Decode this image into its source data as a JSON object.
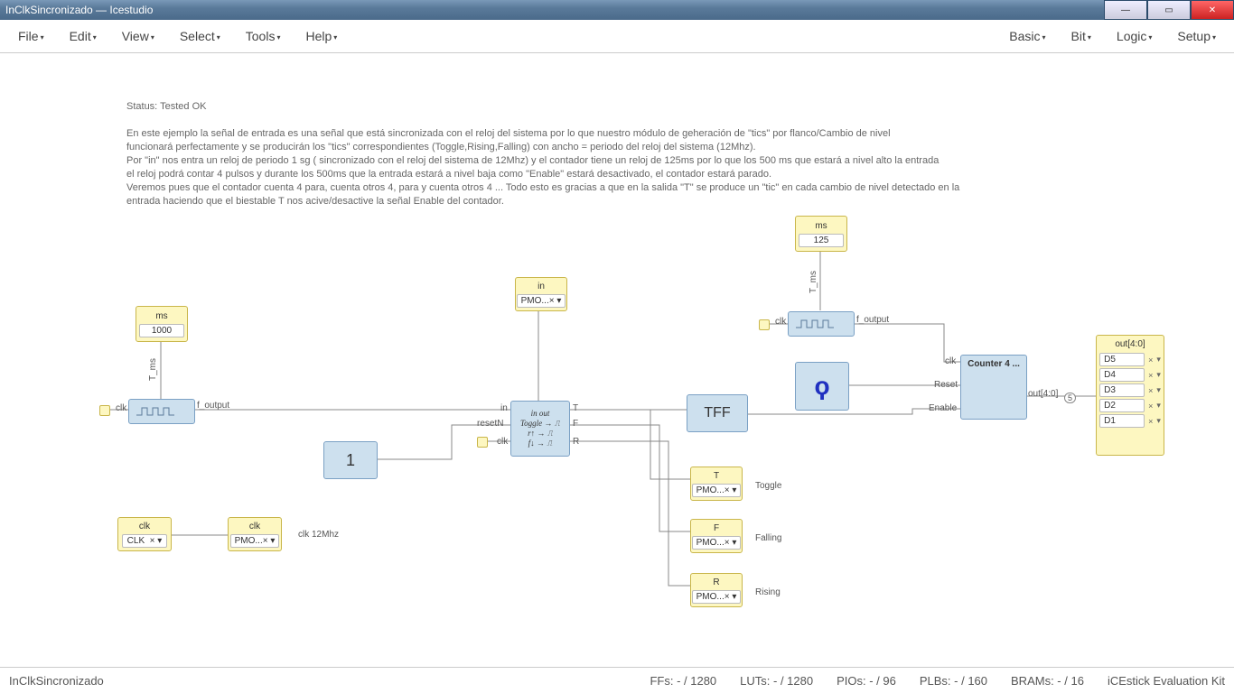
{
  "window": {
    "title": "InClkSincronizado — Icestudio"
  },
  "menus": {
    "left": [
      "File",
      "Edit",
      "View",
      "Select",
      "Tools",
      "Help"
    ],
    "right": [
      "Basic",
      "Bit",
      "Logic",
      "Setup"
    ]
  },
  "info": {
    "status": "Status: Tested OK",
    "p1": "En este ejemplo la señal de entrada es una señal que está sincronizada con el reloj del sistema por lo que nuestro módulo de geheración de \"tics\" por flanco/Cambio de nivel",
    "p2": "funcionará perfectamente y se producirán los \"tics\" correspondientes (Toggle,Rising,Falling) con ancho = periodo del reloj del sistema (12Mhz).",
    "p3": "Por \"in\" nos entra un reloj de periodo 1 sg ( sincronizado con el reloj del sistema de 12Mhz) y el contador tiene un reloj de 125ms por lo que los 500 ms que estará a nivel alto la entrada",
    "p4": "el reloj podrá contar 4 pulsos y durante los 500ms que la entrada estará a nivel baja como \"Enable\" estará desactivado, el contador estará parado.",
    "p5": "Veremos pues que el contador cuenta 4 para, cuenta otros 4, para y cuenta otros 4 ... Todo esto es gracias a que en la salida \"T\" se produce un \"tic\" en cada cambio de nivel detectado en la",
    "p6": "entrada haciendo que el biestable T nos acive/desactive la señal Enable del contador."
  },
  "blocks": {
    "ms1": {
      "title": "ms",
      "value": "1000"
    },
    "ms2": {
      "title": "ms",
      "value": "125"
    },
    "clk_in": {
      "title": "clk",
      "value": "CLK"
    },
    "clk_out": {
      "title": "clk",
      "value": "PMO..."
    },
    "in_pin": {
      "title": "in",
      "value": "PMO..."
    },
    "osc1": {
      "v_label": "T_ms",
      "clk": "clk",
      "out": "f_output"
    },
    "osc2": {
      "v_label": "T_ms",
      "clk": "clk",
      "out": "f_output"
    },
    "one": {
      "label": "1"
    },
    "edge": {
      "in": "in",
      "resetN": "resetN",
      "clk": "clk",
      "T": "T",
      "F": "F",
      "R": "R",
      "cols": "in    out",
      "row1": "Toggle →  ⎍",
      "row2": "r↑  →  ⎍",
      "row3": "f↓  →  ⎍"
    },
    "tff": {
      "label": "TFF"
    },
    "reset_icon": {
      "glyph": "ϙ"
    },
    "counter": {
      "label": "Counter 4 ...",
      "clk": "clk",
      "reset": "Reset",
      "enable": "Enable",
      "out": "out[4:0]"
    },
    "out_t": {
      "title": "T",
      "value": "PMO...",
      "note": "Toggle"
    },
    "out_f": {
      "title": "F",
      "value": "PMO...",
      "note": "Falling"
    },
    "out_r": {
      "title": "R",
      "value": "PMO...",
      "note": "Rising"
    },
    "out_bus": {
      "title": "out[4:0]",
      "rows": [
        {
          "pin": "D5"
        },
        {
          "pin": "D4"
        },
        {
          "pin": "D3"
        },
        {
          "pin": "D2"
        },
        {
          "pin": "D1"
        }
      ]
    },
    "clk12": "clk 12Mhz",
    "bus_tag": "5"
  },
  "status": {
    "project": "InClkSincronizado",
    "ffs": "FFs:  - / 1280",
    "luts": "LUTs:  - / 1280",
    "pios": "PIOs:  - / 96",
    "plbs": "PLBs:  - / 160",
    "brams": "BRAMs:  - / 16",
    "board": "iCEstick Evaluation Kit"
  },
  "glyph": {
    "x": "×",
    "dd": "▾"
  }
}
